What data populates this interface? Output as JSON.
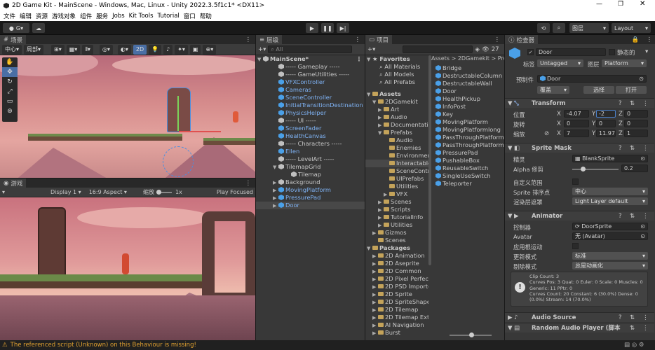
{
  "window": {
    "title": "2D Game Kit - MainScene - Windows, Mac, Linux - Unity 2022.3.5f1c1* <DX11>"
  },
  "menu": [
    "文件",
    "编辑",
    "资源",
    "游戏对象",
    "组件",
    "服务",
    "Jobs",
    "Kit Tools",
    "Tutorial",
    "窗口",
    "帮助"
  ],
  "toolbar": {
    "account": "G",
    "layers": "图层",
    "layout": "Layout"
  },
  "scene": {
    "tab": "场景",
    "pivot": "中心",
    "global": "局部",
    "mode2d": "2D"
  },
  "game": {
    "tab": "游戏",
    "display": "Display 1",
    "aspect": "16:9 Aspect",
    "scale_label": "缩放",
    "scale_value": "1x",
    "play_focused": "Play Focused"
  },
  "hierarchy": {
    "tab": "层级",
    "search_placeholder": "All",
    "items": [
      {
        "label": "MainScene*",
        "bold": true
      },
      {
        "label": "----- Gameplay -----"
      },
      {
        "label": "----- GameUtilities -----"
      },
      {
        "label": "VFXController",
        "blue": true
      },
      {
        "label": "Cameras",
        "blue": true
      },
      {
        "label": "SceneController",
        "blue": true
      },
      {
        "label": "InitialTransitionDestination",
        "blue": true
      },
      {
        "label": "PhysicsHelper",
        "blue": true
      },
      {
        "label": "----- UI -----"
      },
      {
        "label": "ScreenFader",
        "blue": true
      },
      {
        "label": "HealthCanvas",
        "blue": true
      },
      {
        "label": "----- Characters -----"
      },
      {
        "label": "Ellen",
        "blue": true
      },
      {
        "label": "----- LevelArt -----"
      },
      {
        "label": "TilemapGrid"
      },
      {
        "label": "Tilemap"
      },
      {
        "label": "Background"
      },
      {
        "label": "MovingPlatform",
        "blue": true
      },
      {
        "label": "PressurePad",
        "blue": true
      },
      {
        "label": "Door",
        "blue": true
      }
    ]
  },
  "project": {
    "tab": "项目",
    "count": "27",
    "favorites": "Favorites",
    "fav_items": [
      "All Materials",
      "All Models",
      "All Prefabs"
    ],
    "tree": [
      "Assets",
      "2DGamekit",
      "Art",
      "Audio",
      "Documentation",
      "Prefabs",
      "Audio",
      "Enemies",
      "Environment",
      "Interactables",
      "SceneControl",
      "UIPrefabs",
      "Utilities",
      "VFX",
      "Scenes",
      "Scripts",
      "TutorialInfo",
      "Utilities",
      "Gizmos",
      "Scenes",
      "Packages",
      "2D Animation",
      "2D Aseprite",
      "2D Common",
      "2D Pixel Perfect",
      "2D PSD Importer",
      "2D Sprite",
      "2D SpriteShape",
      "2D Tilemap",
      "2D Tilemap Extras",
      "AI Navigation",
      "Burst"
    ],
    "breadcrumb": [
      "Assets",
      "2DGamekit",
      "Prefabs"
    ],
    "assets": [
      "Bridge",
      "DestructableColumn",
      "DestructableWall",
      "Door",
      "HealthPickup",
      "InfoPost",
      "Key",
      "MovingPlatform",
      "MovingPlatformlong",
      "PassThroughPlatform",
      "PassThroughPlatform",
      "PressurePad",
      "PushableBox",
      "ReusableSwitch",
      "SingleUseSwitch",
      "Teleporter"
    ]
  },
  "inspector": {
    "tab": "检查器",
    "name": "Door",
    "static": "静态的",
    "tag_label": "标签",
    "tag": "Untagged",
    "layer_label": "图层",
    "layer": "Platform",
    "prefab_label": "预制件",
    "prefab": "Door",
    "overrides": "覆盖",
    "select": "选择",
    "open": "打开",
    "transform": {
      "title": "Transform",
      "pos_label": "位置",
      "rot_label": "旋转",
      "scale_label": "缩放",
      "px": "-4.07",
      "py": "-2",
      "pz": "0",
      "rx": "0",
      "ry": "0",
      "rz": "0",
      "sx": "7",
      "sy": "11.971",
      "sz": "1"
    },
    "sprite_mask": {
      "title": "Sprite Mask",
      "sprite_label": "精灵",
      "sprite": "BlankSprite",
      "alpha_label": "Alpha 修剪",
      "alpha": "0.2",
      "custom_label": "自定义范围",
      "layer_label": "Sprite 排序点",
      "layer": "中心",
      "mask_label": "渲染层遮罩",
      "mask": "Light Layer default"
    },
    "animator": {
      "title": "Animator",
      "controller_label": "控制器",
      "controller": "DoorSprite",
      "avatar_label": "Avatar",
      "avatar": "无 (Avatar)",
      "root_label": "应用根运动",
      "update_label": "更新模式",
      "update": "标准",
      "cull_label": "剔除模式",
      "cull": "总是动画化",
      "info": [
        "Clip Count: 3",
        "Curves Pos: 3 Quat: 0 Euler: 0 Scale: 0 Muscles: 0",
        "Generic: 11 PPtr: 0",
        "Curves Count: 20 Constant: 6 (30.0%) Dense: 0",
        "(0.0%) Stream: 14 (70.0%)"
      ]
    },
    "audio": {
      "title": "Audio Source"
    },
    "random_audio": {
      "title": "Random Audio Player (脚本"
    }
  },
  "status": {
    "message": "The referenced script (Unknown) on this Behaviour is missing!"
  }
}
